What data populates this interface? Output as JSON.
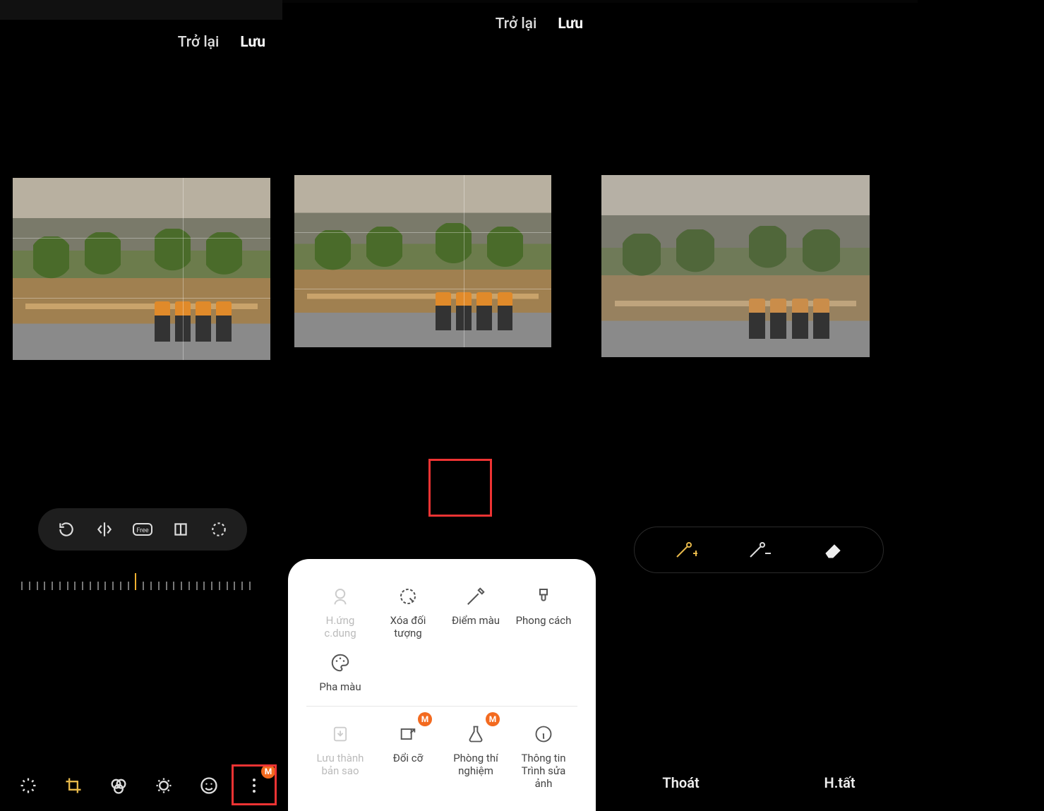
{
  "screen1": {
    "back_label": "Trở lại",
    "save_label": "Lưu",
    "crop_tools": [
      "rotate",
      "flip",
      "free",
      "mirror",
      "shape"
    ],
    "bottom_tools": [
      "auto",
      "crop",
      "filter",
      "adjust",
      "emoji",
      "more"
    ],
    "more_badge": "M"
  },
  "screen2": {
    "back_label": "Trở lại",
    "save_label": "Lưu",
    "panel": {
      "row1": [
        {
          "key": "portrait",
          "label": "H.ứng c.dung",
          "disabled": true
        },
        {
          "key": "object-erase",
          "label": "Xóa đối tượng"
        },
        {
          "key": "spot-color",
          "label": "Điểm màu",
          "highlight": true
        },
        {
          "key": "style",
          "label": "Phong cách"
        }
      ],
      "row2": [
        {
          "key": "color-mix",
          "label": "Pha màu"
        }
      ],
      "row3": [
        {
          "key": "save-copy",
          "label": "Lưu thành bản sao",
          "disabled": true
        },
        {
          "key": "resize",
          "label": "Đổi cỡ",
          "badge": "M"
        },
        {
          "key": "lab",
          "label": "Phòng thí nghiệm",
          "badge": "M"
        },
        {
          "key": "info",
          "label": "Thông tin Trình sửa ảnh"
        }
      ]
    }
  },
  "screen3": {
    "tools": [
      "wand-add",
      "wand-remove",
      "eraser"
    ],
    "exit_label": "Thoát",
    "done_label": "H.tất"
  }
}
